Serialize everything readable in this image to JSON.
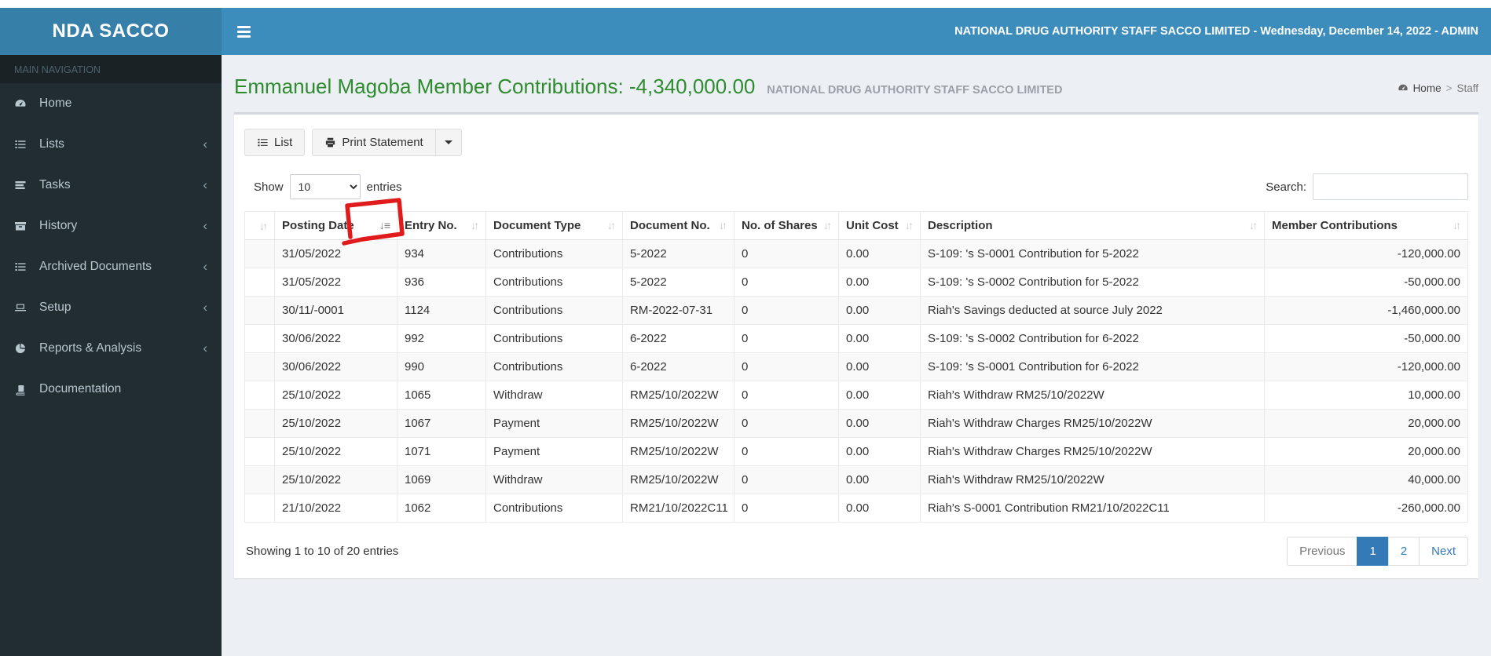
{
  "navbar": {
    "brand": "NDA SACCO",
    "right_text": "NATIONAL DRUG AUTHORITY STAFF SACCO LIMITED - Wednesday, December 14, 2022 - ADMIN"
  },
  "sidebar": {
    "section_label": "MAIN NAVIGATION",
    "items": [
      {
        "label": "Home",
        "icon": "dashboard",
        "expandable": false
      },
      {
        "label": "Lists",
        "icon": "list",
        "expandable": true
      },
      {
        "label": "Tasks",
        "icon": "tasks",
        "expandable": true
      },
      {
        "label": "History",
        "icon": "archive",
        "expandable": true
      },
      {
        "label": "Archived Documents",
        "icon": "list",
        "expandable": true
      },
      {
        "label": "Setup",
        "icon": "laptop",
        "expandable": true
      },
      {
        "label": "Reports & Analysis",
        "icon": "pie-chart",
        "expandable": true
      },
      {
        "label": "Documentation",
        "icon": "book",
        "expandable": false
      }
    ]
  },
  "page_header": {
    "title": "Emmanuel Magoba Member Contributions: -4,340,000.00",
    "subtitle": "NATIONAL DRUG AUTHORITY STAFF SACCO LIMITED",
    "breadcrumb": {
      "home": "Home",
      "separator": ">",
      "current": "Staff"
    }
  },
  "toolbar": {
    "list_label": "List",
    "print_label": "Print Statement"
  },
  "table_controls": {
    "show_label": "Show",
    "entries_label": "entries",
    "page_length": "10",
    "search_label": "Search:",
    "search_value": ""
  },
  "icons": {
    "sort_both": "↓↑",
    "sort_desc": "↓≡",
    "chevron_left": "‹"
  },
  "table": {
    "columns": [
      {
        "label": ""
      },
      {
        "label": "Posting Date"
      },
      {
        "label": "Entry No."
      },
      {
        "label": "Document Type"
      },
      {
        "label": "Document No."
      },
      {
        "label": "No. of Shares"
      },
      {
        "label": "Unit Cost"
      },
      {
        "label": "Description"
      },
      {
        "label": "Member Contributions"
      }
    ],
    "rows": [
      [
        "31/05/2022",
        "934",
        "Contributions",
        "5-2022",
        "0",
        "0.00",
        "S-109: 's S-0001 Contribution for 5-2022",
        "-120,000.00"
      ],
      [
        "31/05/2022",
        "936",
        "Contributions",
        "5-2022",
        "0",
        "0.00",
        "S-109: 's S-0002 Contribution for 5-2022",
        "-50,000.00"
      ],
      [
        "30/11/-0001",
        "1124",
        "Contributions",
        "RM-2022-07-31",
        "0",
        "0.00",
        "Riah's Savings deducted at source July 2022",
        "-1,460,000.00"
      ],
      [
        "30/06/2022",
        "992",
        "Contributions",
        "6-2022",
        "0",
        "0.00",
        "S-109: 's S-0002 Contribution for 6-2022",
        "-50,000.00"
      ],
      [
        "30/06/2022",
        "990",
        "Contributions",
        "6-2022",
        "0",
        "0.00",
        "S-109: 's S-0001 Contribution for 6-2022",
        "-120,000.00"
      ],
      [
        "25/10/2022",
        "1065",
        "Withdraw",
        "RM25/10/2022W",
        "0",
        "0.00",
        "Riah's Withdraw RM25/10/2022W",
        "10,000.00"
      ],
      [
        "25/10/2022",
        "1067",
        "Payment",
        "RM25/10/2022W",
        "0",
        "0.00",
        "Riah's Withdraw Charges RM25/10/2022W",
        "20,000.00"
      ],
      [
        "25/10/2022",
        "1071",
        "Payment",
        "RM25/10/2022W",
        "0",
        "0.00",
        "Riah's Withdraw Charges RM25/10/2022W",
        "20,000.00"
      ],
      [
        "25/10/2022",
        "1069",
        "Withdraw",
        "RM25/10/2022W",
        "0",
        "0.00",
        "Riah's Withdraw RM25/10/2022W",
        "40,000.00"
      ],
      [
        "21/10/2022",
        "1062",
        "Contributions",
        "RM21/10/2022C11",
        "0",
        "0.00",
        "Riah's S-0001 Contribution RM21/10/2022C11",
        "-260,000.00"
      ]
    ]
  },
  "footer": {
    "info": "Showing 1 to 10 of 20 entries",
    "pagination": {
      "previous": "Previous",
      "pages": [
        "1",
        "2"
      ],
      "active": "1",
      "next": "Next"
    }
  },
  "colors": {
    "navbar_blue": "#3c8dbc",
    "logo_blue": "#367fa9",
    "sidebar_dark": "#222d32",
    "title_green": "#2e8b2e",
    "active_page_blue": "#337ab7",
    "annotation_red": "#e01b1b",
    "page_background": "#ecf0f5"
  }
}
